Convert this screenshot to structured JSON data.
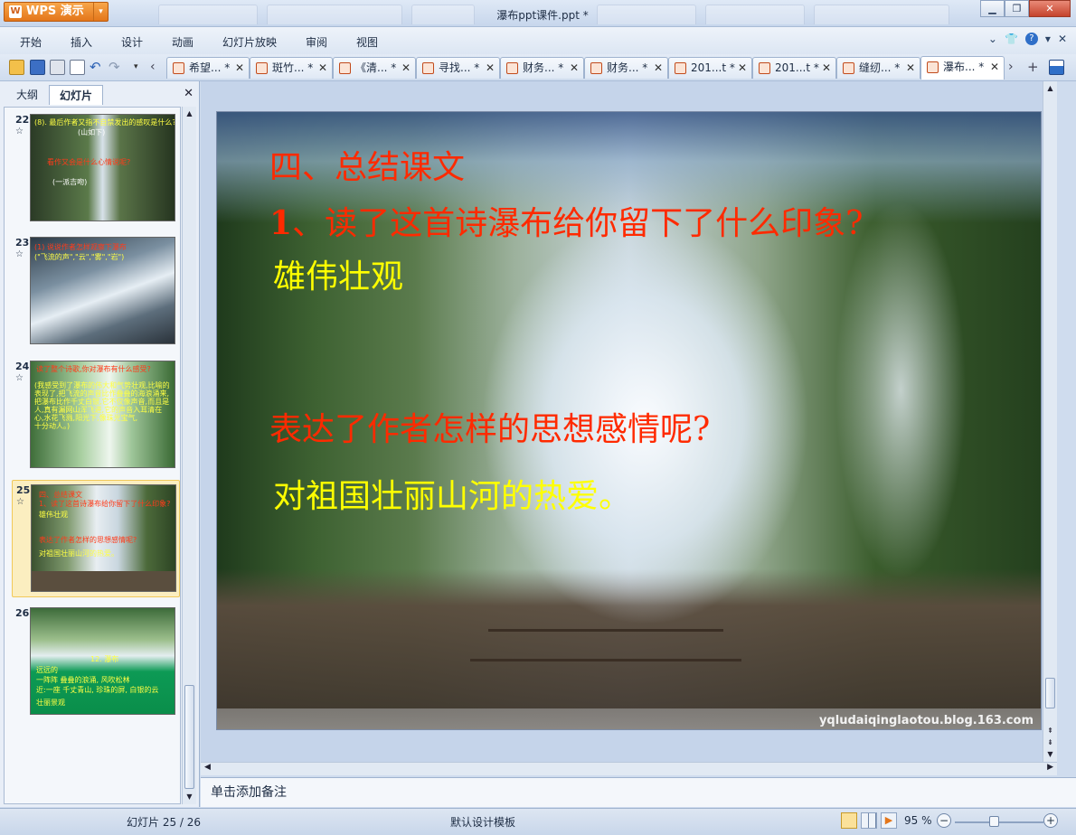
{
  "app": {
    "name": "WPS 演示",
    "window_title": "瀑布ppt课件.ppt *"
  },
  "menu": [
    "开始",
    "插入",
    "设计",
    "动画",
    "幻灯片放映",
    "审阅",
    "视图"
  ],
  "doc_tabs": [
    "希望... *",
    "斑竹... *",
    "《清... *",
    "寻找... *",
    "财务... *",
    "财务... *",
    "201...t *",
    "201...t *",
    "缝纫... *",
    "瀑布... *"
  ],
  "panel": {
    "tab_outline": "大纲",
    "tab_slides": "幻灯片"
  },
  "thumbnails": [
    {
      "num": "22",
      "lines": [
        "(8). 最后作者又指不自禁发出的感叹是什么?",
        "(山如下)",
        "看作又会是什么心情说呢?",
        "(一派吉吻)"
      ]
    },
    {
      "num": "23",
      "lines": [
        "(1) 说说作者怎样观察下瀑布",
        "(\"飞流的声\",\"云\",\"雾\",\"岩\")"
      ]
    },
    {
      "num": "24",
      "lines": [
        "读了整个诗歌,你对瀑布有什么感受?",
        "(我感受到了瀑布的伟大和气势壮观,比喻的",
        "表现了,把飞流的声音比作叠叠的海浪涌来,",
        "把瀑布比作千丈白银,它不仅像声音,而且是",
        "人,真有漏网山浑飞进,它的声音入耳清在",
        "心,水花飞溅,阳光下,像珠光宝气,",
        "十分动人。)"
      ]
    },
    {
      "num": "25",
      "lines": [
        "四、总结课文",
        "1、读了这首诗瀑布给你留下了什么印象?",
        "雄伟壮观",
        "表达了作者怎样的思想感情呢?",
        "对祖国壮丽山河的热爱。"
      ]
    },
    {
      "num": "26",
      "lines": [
        "12. 瀑布",
        "远远的",
        "一阵阵     叠叠的浪涌, 风吹松林",
        "近:一座         千丈青山, 珍珠的屏, 白银的云",
        "         壮丽景观"
      ]
    }
  ],
  "slide": {
    "heading": "四、总结课文",
    "question1_num": "1",
    "question1_text": "、读了这首诗瀑布给你留下了什么印象?",
    "answer1": "雄伟壮观",
    "question2": "表达了作者怎样的思想感情呢?",
    "answer2": "对祖国壮丽山河的热爱。",
    "watermark": "yqludaiqinglaotou.blog.163.com"
  },
  "notes_placeholder": "单击添加备注",
  "status": {
    "slide_info": "幻灯片 25 / 26",
    "template": "默认设计模板",
    "zoom": "95 %"
  },
  "colors": {
    "slide_red": "#ff2a00",
    "slide_yellow": "#ffff00",
    "thumb_yellow": "#ffff44",
    "thumb_red": "#ff3b1a",
    "accent_orange": "#e4761a"
  }
}
